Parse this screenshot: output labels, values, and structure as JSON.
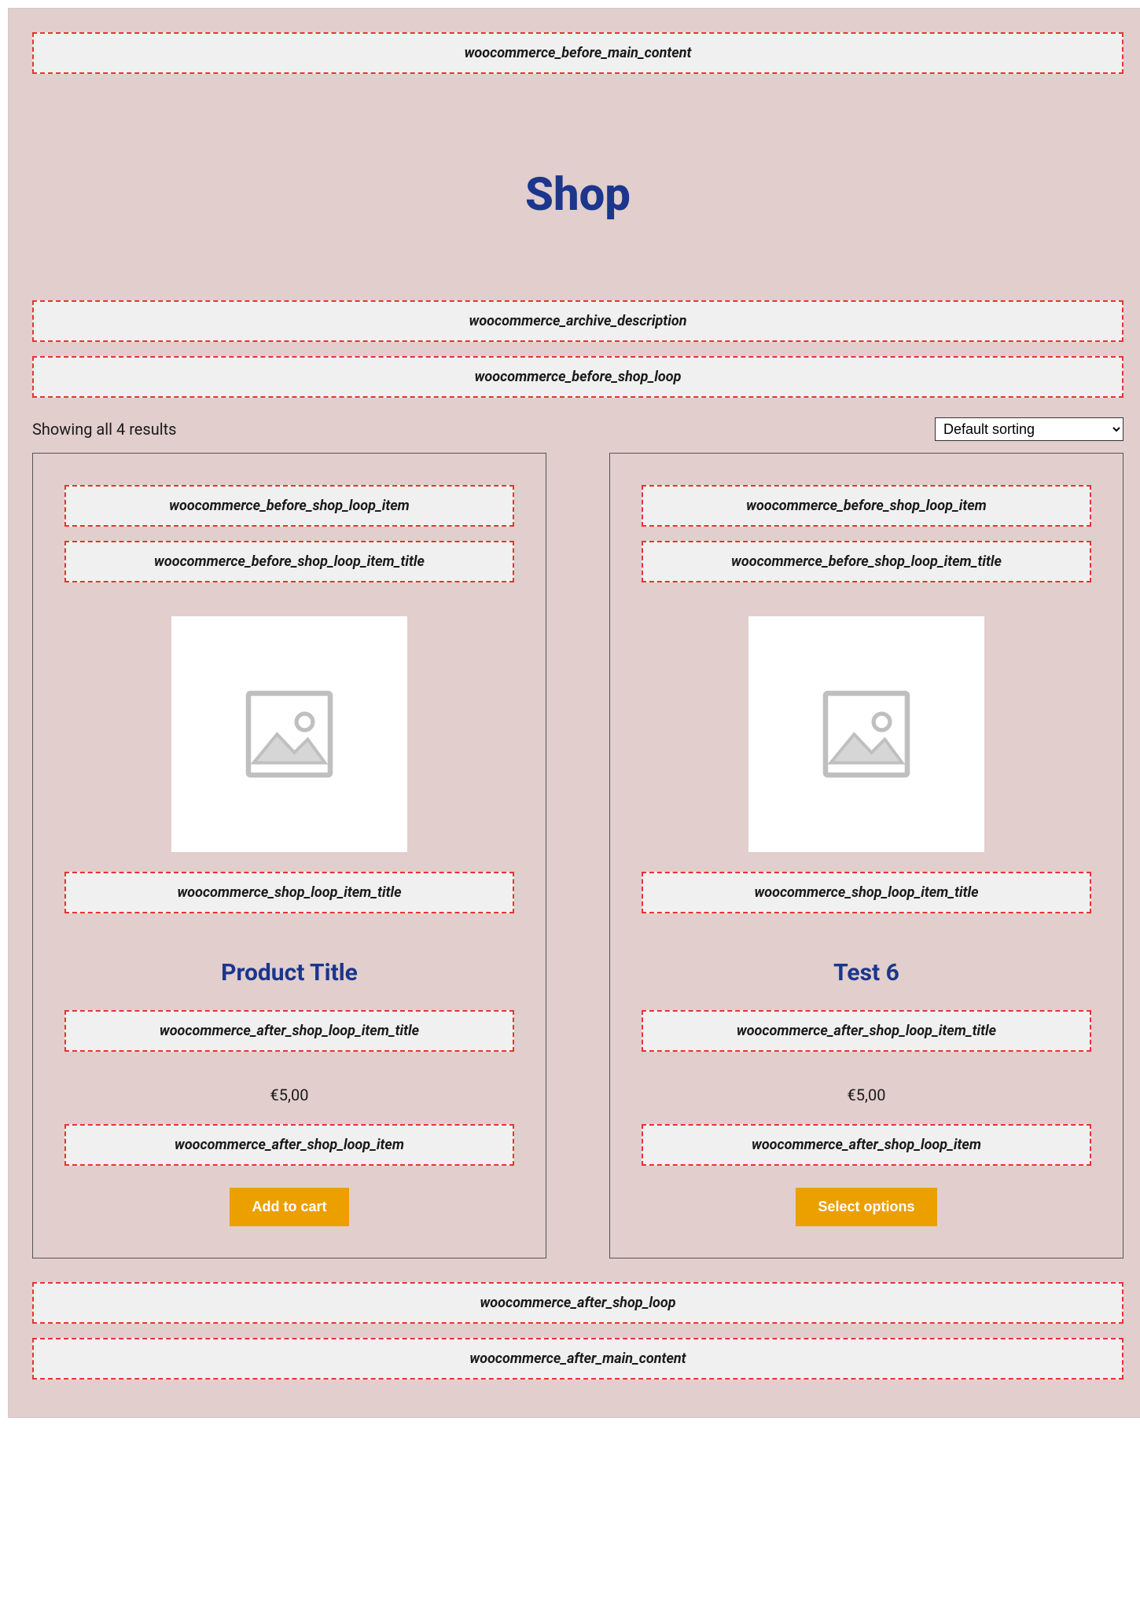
{
  "hooks": {
    "before_main_content": "woocommerce_before_main_content",
    "archive_description": "woocommerce_archive_description",
    "before_shop_loop": "woocommerce_before_shop_loop",
    "after_shop_loop": "woocommerce_after_shop_loop",
    "after_main_content": "woocommerce_after_main_content",
    "before_shop_loop_item": "woocommerce_before_shop_loop_item",
    "before_shop_loop_item_title": "woocommerce_before_shop_loop_item_title",
    "shop_loop_item_title": "woocommerce_shop_loop_item_title",
    "after_shop_loop_item_title": "woocommerce_after_shop_loop_item_title",
    "after_shop_loop_item": "woocommerce_after_shop_loop_item"
  },
  "page_title": "Shop",
  "result_count": "Showing all 4 results",
  "sort_selected": "Default sorting",
  "products": [
    {
      "title": "Product Title",
      "price": "€5,00",
      "button": "Add to cart"
    },
    {
      "title": "Test 6",
      "price": "€5,00",
      "button": "Select options"
    }
  ]
}
